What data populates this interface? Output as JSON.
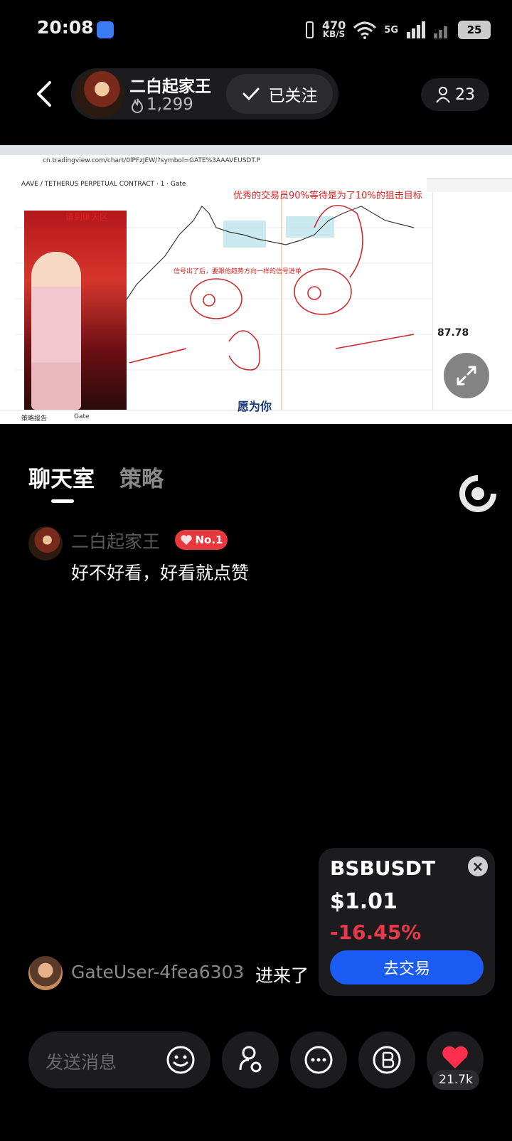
{
  "status_bar": {
    "time": "20:08",
    "net_speed_value": "470",
    "net_speed_unit": "KB/S",
    "network_label": "5G",
    "battery": "25"
  },
  "header": {
    "host_name": "二白起家王",
    "host_popularity": "1,299",
    "follow_label": "已关注",
    "viewer_count": "23"
  },
  "video": {
    "url_text": "cn.tradingview.com/chart/0lPFzJEW/?symbol=GATE%3AAAVEUSDT.P",
    "symbol_text": "AAVE / TETHERUS PERPETUAL CONTRACT · 1 · Gate",
    "annotation_top": "优秀的交易员90%等待是为了10%的狙击目标",
    "annotation_mid": "信号出了后，要跟他趋势方向一样的信号进单",
    "annotation_room": "请到聊天区",
    "caption": "愿为你",
    "price_now": "87.78",
    "taskbar_item1": "策略报告",
    "taskbar_item2": "Gate"
  },
  "tabs": {
    "chat": "聊天室",
    "strategy": "策略"
  },
  "messages": [
    {
      "name": "二白起家王",
      "badge": "No.1",
      "text": "好不好看，好看就点赞"
    }
  ],
  "join_notice": {
    "name": "GateUser-4fea6303",
    "suffix": "进来了"
  },
  "ticker": {
    "symbol": "BSBUSDT",
    "price": "$1.01",
    "change": "-16.45%",
    "button": "去交易"
  },
  "bottom_bar": {
    "input_placeholder": "发送消息",
    "like_count": "21.7k"
  },
  "colors": {
    "accent_blue": "#1b5cf4",
    "down_red": "#e63a4c",
    "badge_red": "#e8383d"
  }
}
